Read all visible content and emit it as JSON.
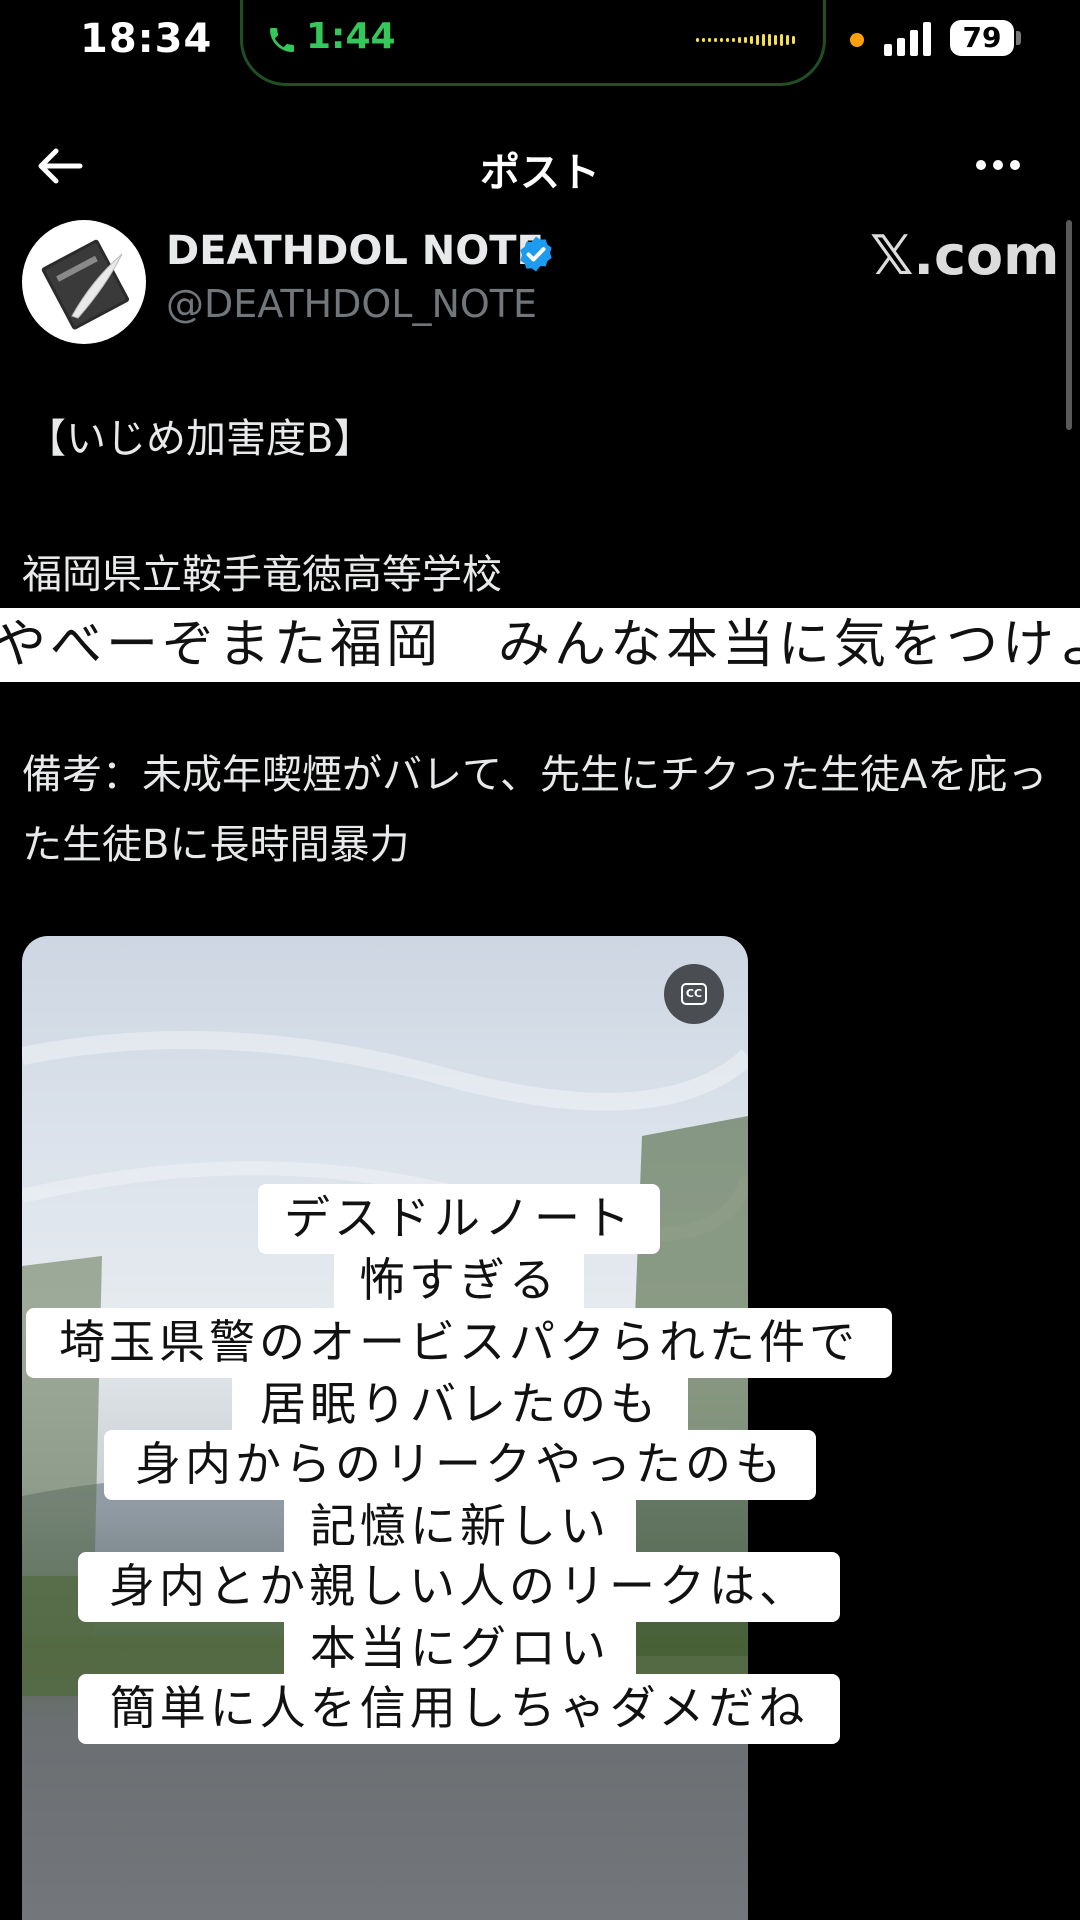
{
  "status_bar": {
    "time": "18:34",
    "call_duration": "1:44",
    "battery": "79"
  },
  "header": {
    "title": "ポスト"
  },
  "author": {
    "display_name": "DEATHDOL NOTE",
    "handle": "@DEATHDOL_NOTE",
    "verified": true
  },
  "watermark": "𝕏.com",
  "post": {
    "tag_line": "【いじめ加害度B】",
    "school_line": "福岡県立鞍手竜徳高等学校",
    "note_line": "備考：未成年喫煙がバレて、先生にチクった生徒Aを庇った生徒Bに長時間暴力"
  },
  "overlay_comment": "やべーぞまた福岡　みんな本当に気をつけよ",
  "video_captions": [
    "デスドルノート",
    "怖すぎる",
    "埼玉県警のオービスパクられた件で",
    "居眠りバレたのも",
    "身内からのリークやったのも",
    "記憶に新しい",
    "身内とか親しい人のリークは、",
    "本当にグロい",
    "簡単に人を信用しちゃダメだね"
  ],
  "colors": {
    "background": "#000000",
    "call_green": "#34c759",
    "verified_blue": "#1d9bf0",
    "handle_grey": "#71767b"
  },
  "icons": [
    "phone-icon",
    "back-arrow-icon",
    "more-icon",
    "verified-icon",
    "closed-captions-icon",
    "sweat-drop-icon"
  ]
}
